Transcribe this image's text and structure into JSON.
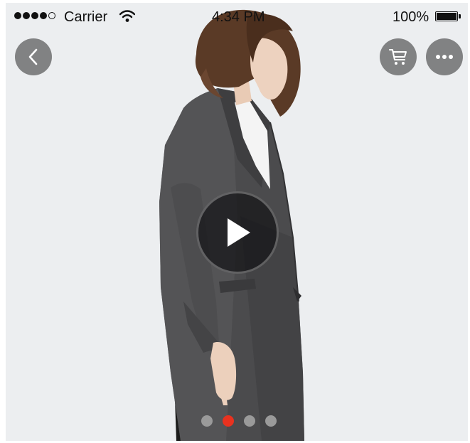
{
  "status_bar": {
    "carrier": "Carrier",
    "time": "4:34 PM",
    "battery": "100%",
    "signal_bars_filled": 4,
    "signal_bars_total": 5
  },
  "nav": {
    "back_icon": "chevron-left-icon",
    "cart_icon": "shopping-cart-icon",
    "more_icon": "more-horizontal-icon"
  },
  "media": {
    "play_icon": "play-icon",
    "page_count": 4,
    "active_page": 2
  },
  "colors": {
    "active_dot": "#e8321f",
    "inactive_dot": "#9a9a9a",
    "overlay_button": "#6e6e70",
    "background": "#eceef0"
  }
}
